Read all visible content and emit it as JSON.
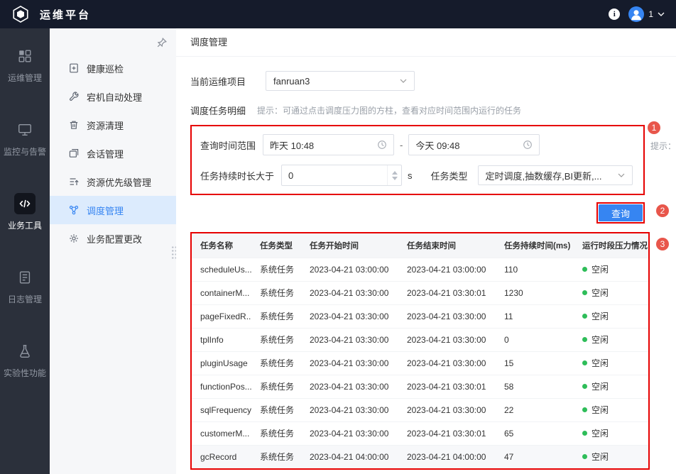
{
  "header": {
    "title": "运维平台",
    "user_count": "1"
  },
  "primary_nav": {
    "items": [
      {
        "label": "运维管理"
      },
      {
        "label": "监控与告警"
      },
      {
        "label": "业务工具"
      },
      {
        "label": "日志管理"
      },
      {
        "label": "实验性功能"
      }
    ]
  },
  "secondary_nav": {
    "items": [
      {
        "label": "健康巡检"
      },
      {
        "label": "宕机自动处理"
      },
      {
        "label": "资源清理"
      },
      {
        "label": "会话管理"
      },
      {
        "label": "资源优先级管理"
      },
      {
        "label": "调度管理"
      },
      {
        "label": "业务配置更改"
      }
    ]
  },
  "main": {
    "breadcrumb": "调度管理",
    "project": {
      "label": "当前运维项目",
      "value": "fanruan3"
    },
    "detail": {
      "label": "调度任务明细",
      "hint": "提示：可通过点击调度压力图的方柱，查看对应时间范围内运行的任务"
    },
    "filters": {
      "time_label": "查询时间范围",
      "time_start": "昨天  10:48",
      "time_separator": "-",
      "time_end": "今天  09:48",
      "side_hint": "提示：只支持查询当前",
      "duration_label": "任务持续时长大于",
      "duration_value": "0",
      "duration_unit": "s",
      "type_label": "任务类型",
      "type_value": "定时调度,抽数缓存,BI更新,..."
    },
    "query_button": "查询",
    "annotations": [
      "1",
      "2",
      "3"
    ],
    "table": {
      "columns": [
        "任务名称",
        "任务类型",
        "任务开始时间",
        "任务结束时间",
        "任务持续时间(ms)",
        "运行时段压力情况"
      ],
      "rows": [
        {
          "name": "scheduleUs...",
          "type": "系统任务",
          "start": "2023-04-21 03:00:00",
          "end": "2023-04-21 03:00:00",
          "duration": "110",
          "pressure": "空闲"
        },
        {
          "name": "containerM...",
          "type": "系统任务",
          "start": "2023-04-21 03:30:00",
          "end": "2023-04-21 03:30:01",
          "duration": "1230",
          "pressure": "空闲"
        },
        {
          "name": "pageFixedR...",
          "type": "系统任务",
          "start": "2023-04-21 03:30:00",
          "end": "2023-04-21 03:30:00",
          "duration": "11",
          "pressure": "空闲"
        },
        {
          "name": "tplInfo",
          "type": "系统任务",
          "start": "2023-04-21 03:30:00",
          "end": "2023-04-21 03:30:00",
          "duration": "0",
          "pressure": "空闲"
        },
        {
          "name": "pluginUsage",
          "type": "系统任务",
          "start": "2023-04-21 03:30:00",
          "end": "2023-04-21 03:30:00",
          "duration": "15",
          "pressure": "空闲"
        },
        {
          "name": "functionPos...",
          "type": "系统任务",
          "start": "2023-04-21 03:30:00",
          "end": "2023-04-21 03:30:01",
          "duration": "58",
          "pressure": "空闲"
        },
        {
          "name": "sqlFrequency",
          "type": "系统任务",
          "start": "2023-04-21 03:30:00",
          "end": "2023-04-21 03:30:00",
          "duration": "22",
          "pressure": "空闲"
        },
        {
          "name": "customerM...",
          "type": "系统任务",
          "start": "2023-04-21 03:30:00",
          "end": "2023-04-21 03:30:01",
          "duration": "65",
          "pressure": "空闲"
        },
        {
          "name": "gcRecord",
          "type": "系统任务",
          "start": "2023-04-21 04:00:00",
          "end": "2023-04-21 04:00:00",
          "duration": "47",
          "pressure": "空闲"
        }
      ]
    }
  },
  "colors": {
    "accent": "#3685f2",
    "annotation_border": "#e60000",
    "annotation_badge": "#e8564b",
    "status_idle": "#2ebd59"
  }
}
